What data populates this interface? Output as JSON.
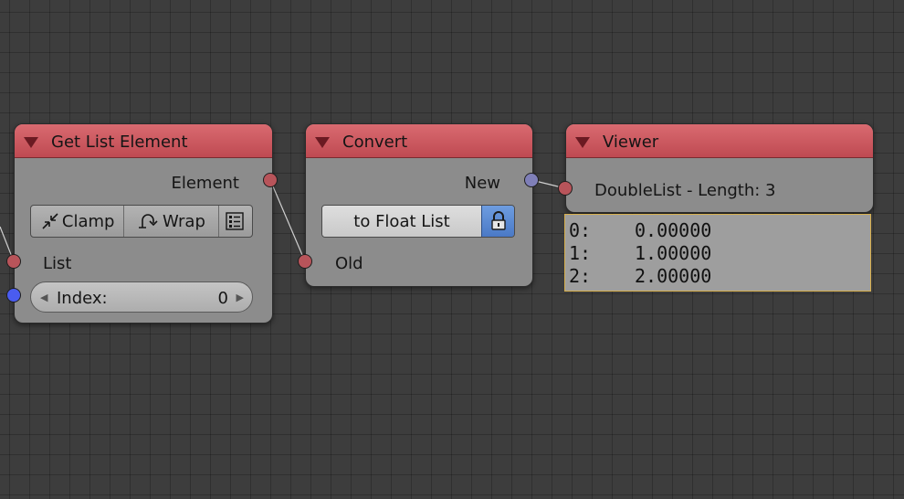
{
  "nodes": {
    "get_list_element": {
      "title": "Get List Element",
      "output_label": "Element",
      "buttons": {
        "clamp": "Clamp",
        "wrap": "Wrap"
      },
      "input_list_label": "List",
      "index_label": "Index:",
      "index_value": "0"
    },
    "convert": {
      "title": "Convert",
      "output_label": "New",
      "field_value": "to Float List",
      "input_label": "Old"
    },
    "viewer": {
      "title": "Viewer",
      "info": "DoubleList - Length: 3",
      "rows": [
        {
          "index": "0:",
          "value": "0.00000"
        },
        {
          "index": "1:",
          "value": "1.00000"
        },
        {
          "index": "2:",
          "value": "2.00000"
        }
      ]
    }
  },
  "colors": {
    "header": "#c8545b",
    "node_body": "#8c8c8c",
    "socket_list": "#b8545a",
    "socket_generic": "#7f7fb8",
    "socket_int": "#4a5cf0",
    "lock_active": "#4a79c6",
    "output_border": "#d7b04e"
  },
  "icons": [
    "collapse-triangle-icon",
    "clamp-icon",
    "wrap-icon",
    "list-settings-icon",
    "lock-icon",
    "decrement-arrow-icon",
    "increment-arrow-icon"
  ]
}
